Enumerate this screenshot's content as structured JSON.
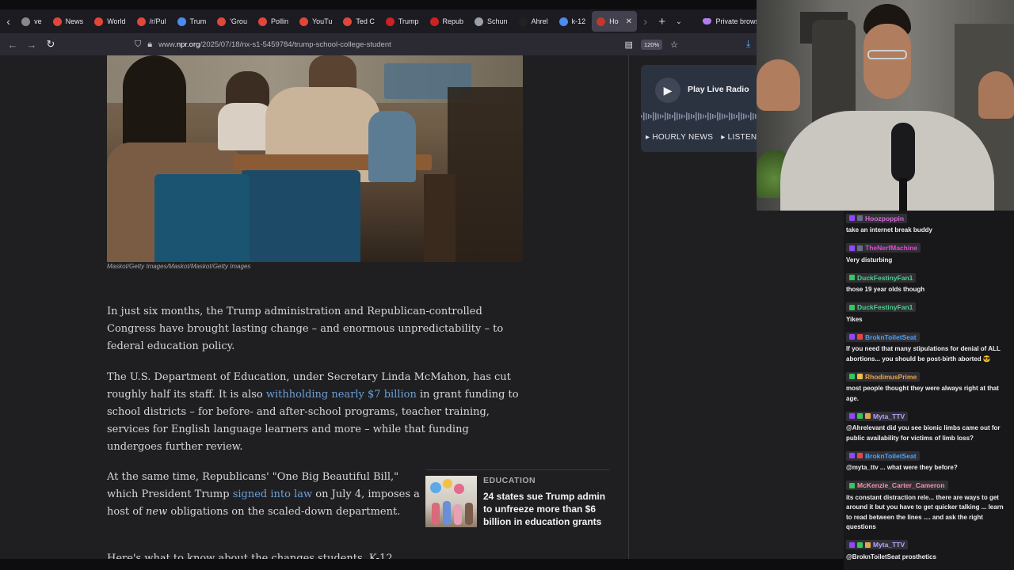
{
  "browser": {
    "tabs": [
      {
        "label": "ve",
        "color": "#888888"
      },
      {
        "label": "News",
        "color": "#e0463a"
      },
      {
        "label": "World",
        "color": "#e0463a"
      },
      {
        "label": "/r/Pul",
        "color": "#e0463a"
      },
      {
        "label": "Trum",
        "color": "#4a8cf0"
      },
      {
        "label": "'Grou",
        "color": "#e0463a"
      },
      {
        "label": "Pollin",
        "color": "#e0463a"
      },
      {
        "label": "YouTu",
        "color": "#e0463a"
      },
      {
        "label": "Ted C",
        "color": "#e0463a"
      },
      {
        "label": "Trump",
        "color": "#cc2222"
      },
      {
        "label": "Repub",
        "color": "#cc2222"
      },
      {
        "label": "Schun",
        "color": "#9aa0aa"
      },
      {
        "label": "Ahrel",
        "color": "#222222"
      },
      {
        "label": "k-12",
        "color": "#4a8cf0"
      },
      {
        "label": "Ho",
        "color": "#c0392b",
        "active": true
      }
    ],
    "private_label": "Private browsi",
    "url_prefix": "www.",
    "url_domain": "npr.org",
    "url_path": "/2025/07/18/nx-s1-5459784/trump-school-college-student",
    "zoom": "120%"
  },
  "article": {
    "image_caption": "Maskot/Getty Images/Maskot/Maskot/Getty Images",
    "p1": "In just six months, the Trump administration and Republican-controlled Congress have brought lasting change – and enormous unpredictability – to federal education policy.",
    "p2_a": "The U.S. Department of Education, under Secretary Linda McMahon, has cut roughly half its staff. It is also ",
    "p2_link": "withholding nearly $7 billion",
    "p2_b": " in grant funding to school districts – for before- and after-school programs, teacher training, services for English language learners and more – while that funding undergoes further review.",
    "p3_a": "At the same time, Republicans' \"One Big Beautiful Bill,\" which President Trump ",
    "p3_link": "signed into law",
    "p3_b": " on July 4, imposes a host of ",
    "p3_em": "new",
    "p3_c": " obligations on the scaled-down department.",
    "p4": "Here's what to know about the changes students, K-12",
    "related": {
      "category": "Education",
      "title": "24 states sue Trump admin to unfreeze more than $6 billion in education grants"
    }
  },
  "radio": {
    "play_label": "Play Live Radio",
    "hourly": "▸ HOURLY NEWS",
    "listen": "▸ LISTEN LI"
  },
  "chat": [
    {
      "user": "Hoozpoppin",
      "color": "#d66fd6",
      "badges": [
        "#9146ff",
        "#6a6a8a"
      ],
      "text": "take an internet break buddy"
    },
    {
      "user": "TheNerfMachine",
      "color": "#e04ccf",
      "badges": [
        "#9146ff",
        "#6a6a8a"
      ],
      "text": "Very disturbing"
    },
    {
      "user": "DuckFestinyFan1",
      "color": "#4ccf8a",
      "badges": [
        "#34c759"
      ],
      "text": "those 19 year olds though"
    },
    {
      "user": "DuckFestinyFan1",
      "color": "#4ccf8a",
      "badges": [
        "#34c759"
      ],
      "text": "Yikes"
    },
    {
      "user": "BroknToiletSeat",
      "color": "#4aa3ff",
      "badges": [
        "#9146ff",
        "#e84545"
      ],
      "text": "If you need that many stipulations for denial of ALL abortions... you should be post-birth aborted 😎"
    },
    {
      "user": "RhodimusPrime",
      "color": "#e8a34a",
      "badges": [
        "#34c759",
        "#e8c04a"
      ],
      "text": "most people thought they were always right at that age."
    },
    {
      "user": "Myta_TTV",
      "color": "#b9a4ff",
      "badges": [
        "#9146ff",
        "#34c759",
        "#e8a34a"
      ],
      "text": "@Ahrelevant did you see bionic limbs came out for public availability for victims of limb loss?"
    },
    {
      "user": "BroknToiletSeat",
      "color": "#4aa3ff",
      "badges": [
        "#9146ff",
        "#e84545"
      ],
      "text": "@myta_ttv ... what were they before?"
    },
    {
      "user": "McKenzie_Carter_Cameron",
      "color": "#ff8fa3",
      "badges": [
        "#34c759"
      ],
      "text": "its constant distraction rele... there are ways to get around it but you have to get quicker talking ... learn to read between the lines .... and ask the right questions"
    },
    {
      "user": "Myta_TTV",
      "color": "#b9a4ff",
      "badges": [
        "#9146ff",
        "#34c759",
        "#e8a34a"
      ],
      "text": "@BroknToiletSeat prosthetics"
    }
  ]
}
